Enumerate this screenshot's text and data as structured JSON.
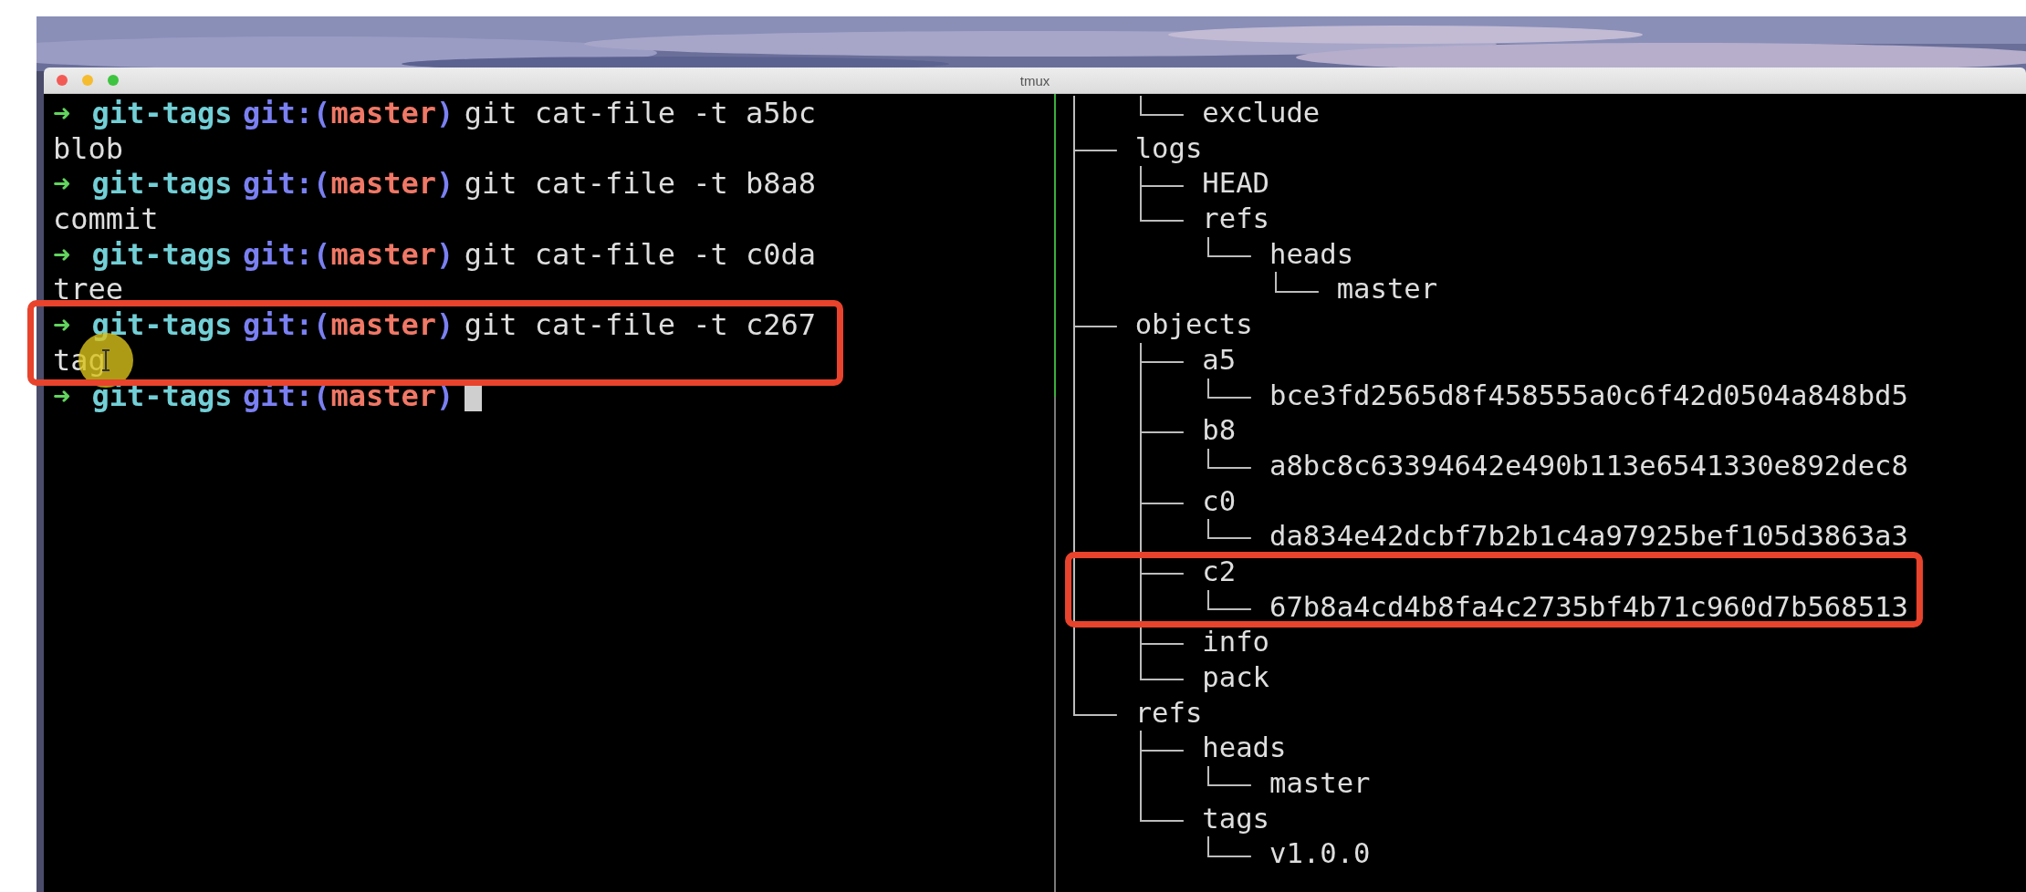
{
  "window": {
    "title": "tmux"
  },
  "left_pane": {
    "lines": [
      {
        "kind": "prompt",
        "arrow": "➜",
        "directory": "git-tags",
        "branch_open": "git:(",
        "branch": "master",
        "branch_close": ")",
        "command": "git cat-file -t a5bc",
        "cursor": false,
        "boxed": false
      },
      {
        "kind": "output",
        "text": "blob",
        "boxed": false
      },
      {
        "kind": "prompt",
        "arrow": "➜",
        "directory": "git-tags",
        "branch_open": "git:(",
        "branch": "master",
        "branch_close": ")",
        "command": "git cat-file -t b8a8",
        "cursor": false,
        "boxed": false
      },
      {
        "kind": "output",
        "text": "commit",
        "boxed": false
      },
      {
        "kind": "prompt",
        "arrow": "➜",
        "directory": "git-tags",
        "branch_open": "git:(",
        "branch": "master",
        "branch_close": ")",
        "command": "git cat-file -t c0da",
        "cursor": false,
        "boxed": false
      },
      {
        "kind": "output",
        "text": "tree",
        "boxed": false
      },
      {
        "kind": "prompt",
        "arrow": "➜",
        "directory": "git-tags",
        "branch_open": "git:(",
        "branch": "master",
        "branch_close": ")",
        "command": "git cat-file -t c267",
        "cursor": false,
        "boxed": true
      },
      {
        "kind": "output",
        "text": "tag",
        "boxed": true,
        "pointer": true
      },
      {
        "kind": "prompt",
        "arrow": "➜",
        "directory": "git-tags",
        "branch_open": "git:(",
        "branch": "master",
        "branch_close": ")",
        "cursor": true,
        "boxed": false
      }
    ]
  },
  "right_pane": {
    "tree": [
      {
        "children": [
          {
            "name": "exclude",
            "boxed": false
          }
        ]
      },
      {
        "name": "logs",
        "boxed": false,
        "children": [
          {
            "name": "HEAD",
            "boxed": false
          },
          {
            "name": "refs",
            "boxed": false,
            "children": [
              {
                "name": "heads",
                "boxed": false,
                "children": [
                  {
                    "name": "master",
                    "boxed": false
                  }
                ]
              }
            ]
          }
        ]
      },
      {
        "name": "objects",
        "boxed": false,
        "children": [
          {
            "name": "a5",
            "boxed": false,
            "children": [
              {
                "name": "bce3fd2565d8f458555a0c6f42d0504a848bd5",
                "boxed": false
              }
            ]
          },
          {
            "name": "b8",
            "boxed": false,
            "children": [
              {
                "name": "a8bc8c63394642e490b113e6541330e892dec8",
                "boxed": false
              }
            ]
          },
          {
            "name": "c0",
            "boxed": false,
            "children": [
              {
                "name": "da834e42dcbf7b2b1c4a97925bef105d3863a3",
                "boxed": false
              }
            ]
          },
          {
            "name": "c2",
            "boxed": true,
            "children": [
              {
                "name": "67b8a4cd4b8fa4c2735bf4b71c960d7b568513",
                "boxed": true
              }
            ]
          },
          {
            "name": "info",
            "boxed": false
          },
          {
            "name": "pack",
            "boxed": false
          }
        ]
      },
      {
        "name": "refs",
        "boxed": false,
        "children": [
          {
            "name": "heads",
            "boxed": false,
            "children": [
              {
                "name": "master",
                "boxed": false
              }
            ]
          },
          {
            "name": "tags",
            "boxed": false,
            "children": [
              {
                "name": "v1.0.0",
                "boxed": false
              }
            ]
          }
        ]
      }
    ]
  }
}
